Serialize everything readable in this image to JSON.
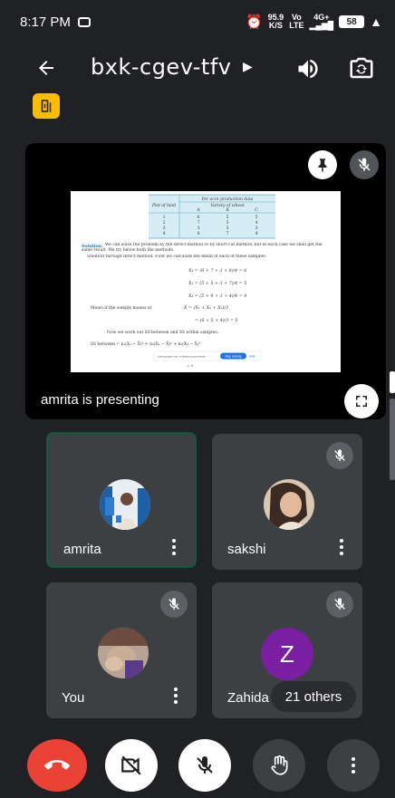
{
  "status_bar": {
    "time": "8:17 PM",
    "speed_value": "95.9",
    "speed_unit": "K/S",
    "carrier": "Vo",
    "carrier_sub": "LTE",
    "network": "4G+",
    "battery": "58"
  },
  "header": {
    "meeting_code": "bxk-cgev-tfv"
  },
  "presentation": {
    "label": "amrita is presenting",
    "document": {
      "table_header_main": "Per acre production data",
      "table_header_sub": "Variety of wheat",
      "row_header": "Plot of land",
      "columns": [
        "A",
        "B",
        "C"
      ],
      "rows": [
        [
          "1",
          "6",
          "5",
          "5"
        ],
        [
          "2",
          "7",
          "5",
          "4"
        ],
        [
          "3",
          "3",
          "3",
          "3"
        ],
        [
          "4",
          "8",
          "7",
          "4"
        ]
      ],
      "solution_label": "Solution:",
      "solution_text": "We can solve the problem by the direct method or by short-cut method, but in each case we shall get the same result. We try below both the methods.",
      "direct_text": "Solution through direct method: First we calculate the mean of each of these samples:",
      "eq1": "X₁ = (6 + 7 + 3 + 8)/4 = 6",
      "eq2": "X₂ = (5 + 5 + 3 + 7)/4 = 5",
      "eq3": "X₃ = (5 + 4 + 3 + 4)/4 = 4",
      "mean_label": "Mean of the sample means or",
      "mean_eq": "X̄ = (X₁ + X₂ + X₃)/3",
      "mean_eq2": "= (6 + 5 + 4)/3 = 5",
      "work_text": "Now we work out SS between and SS within samples:",
      "ss_text": "SS between = n₁(X₁ − X̄)² + n₂(X₂ − X̄)² + n₃(X₃ − X̄)²",
      "share_text": "meet.google.com is sharing your screen",
      "stop_sharing": "Stop sharing",
      "hide": "Hide"
    }
  },
  "participants": [
    {
      "name": "amrita",
      "muted": false,
      "active": true
    },
    {
      "name": "sakshi",
      "muted": true,
      "active": false
    },
    {
      "name": "You",
      "muted": true,
      "active": false
    },
    {
      "name": "Zahida",
      "initial": "Z",
      "muted": true,
      "active": false,
      "others_label": "21 others"
    }
  ],
  "colors": {
    "background": "#202124",
    "tile": "#3c4043",
    "end_call": "#ea4335",
    "active_border": "#0f5c3b",
    "badge": "#fbbc04",
    "avatar_z": "#7b1fa2"
  },
  "icons": {
    "back": "arrow-left-icon",
    "speaker": "speaker-icon",
    "camera_flip": "camera-flip-icon",
    "pin": "pin-icon",
    "mic_off": "mic-off-icon",
    "fullscreen": "fullscreen-icon",
    "end_call": "phone-hangup-icon",
    "video_off": "video-off-icon",
    "hand": "raise-hand-icon",
    "more": "more-vert-icon"
  }
}
